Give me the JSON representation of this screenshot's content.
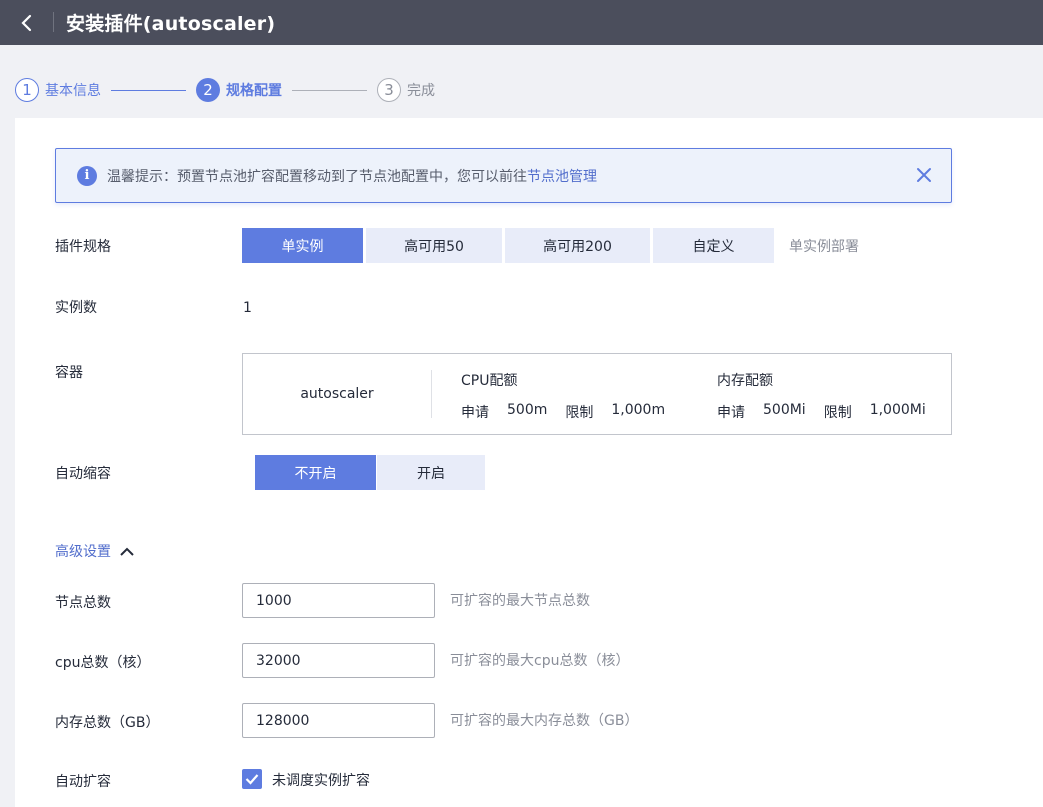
{
  "header": {
    "title": "安装插件(autoscaler)"
  },
  "steps": [
    {
      "num": "1",
      "label": "基本信息"
    },
    {
      "num": "2",
      "label": "规格配置"
    },
    {
      "num": "3",
      "label": "完成"
    }
  ],
  "alert": {
    "text": "温馨提示：预置节点池扩容配置移动到了节点池配置中，您可以前往",
    "link": "节点池管理"
  },
  "spec": {
    "label": "插件规格",
    "options": [
      "单实例",
      "高可用50",
      "高可用200",
      "自定义"
    ],
    "selected": "单实例",
    "hint": "单实例部署"
  },
  "instances": {
    "label": "实例数",
    "value": "1"
  },
  "container": {
    "label": "容器",
    "name": "autoscaler",
    "cpu": {
      "title": "CPU配额",
      "request_label": "申请",
      "request": "500m",
      "limit_label": "限制",
      "limit": "1,000m"
    },
    "memory": {
      "title": "内存配额",
      "request_label": "申请",
      "request": "500Mi",
      "limit_label": "限制",
      "limit": "1,000Mi"
    }
  },
  "scale_down": {
    "label": "自动缩容",
    "options": [
      "不开启",
      "开启"
    ],
    "selected": "不开启"
  },
  "advanced": {
    "label": "高级设置"
  },
  "node_total": {
    "label": "节点总数",
    "value": "1000",
    "hint": "可扩容的最大节点总数"
  },
  "cpu_total": {
    "label": "cpu总数（核）",
    "value": "32000",
    "hint": "可扩容的最大cpu总数（核）"
  },
  "mem_total": {
    "label": "内存总数（GB）",
    "value": "128000",
    "hint": "可扩容的最大内存总数（GB）"
  },
  "auto_scale": {
    "label": "自动扩容",
    "checkbox_label": "未调度实例扩容",
    "checked": true
  },
  "colors": {
    "accent": "#5e7ce0",
    "topbar": "#4b4e5c",
    "segment_bg": "#e8ecf9"
  }
}
